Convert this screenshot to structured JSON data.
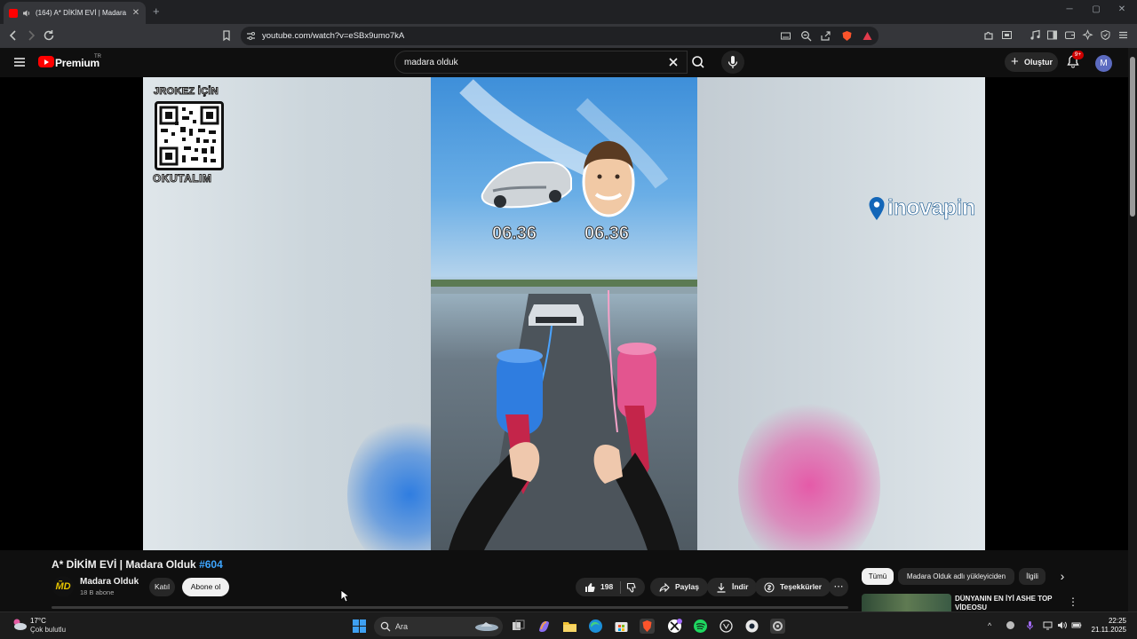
{
  "browser": {
    "tab_title": "(164) A* DİKİM EVİ | Madara",
    "new_tab": "+",
    "url": "youtube.com/watch?v=eSBx9umo7kA",
    "window_controls": [
      "─",
      "▢",
      "✕"
    ]
  },
  "youtube": {
    "brand": "Premium",
    "region": "TR",
    "search_query": "madara olduk",
    "create_label": "Oluştur",
    "notification_count": "9+",
    "avatar_letter": "M"
  },
  "video": {
    "overlay_qr_top": "JROKEZ İÇİN",
    "overlay_qr_bottom": "OKUTALIM",
    "sponsor": "inovapin",
    "timer_left": "06.36",
    "timer_right": "06.36",
    "watermark": "M̃D",
    "title": "A* DİKİM EVİ | Madara Olduk",
    "hashtag": "#604",
    "channel_name": "Madara Olduk",
    "subscribers": "18 B abone",
    "join_label": "Katıl",
    "subscribe_label": "Abone ol",
    "like_count": "198",
    "share_label": "Paylaş",
    "download_label": "İndir",
    "thanks_label": "Teşekkürler",
    "more_label": "⋯"
  },
  "sidebar": {
    "chips": [
      "Tümü",
      "Madara Olduk adlı yükleyiciden",
      "İlgili"
    ],
    "next_arrow": "›",
    "rec_title": "DÜNYANIN EN İYİ ASHE TOP VİDEOSU",
    "rec_more": "⋮"
  },
  "taskbar": {
    "temperature": "17°C",
    "weather": "Çok bulutlu",
    "search_placeholder": "Ara",
    "time": "22:25",
    "date": "21.11.2025"
  },
  "colors": {
    "yt_red": "#ff0000",
    "link_blue": "#3ea6ff",
    "background": "#0f0f0f"
  }
}
